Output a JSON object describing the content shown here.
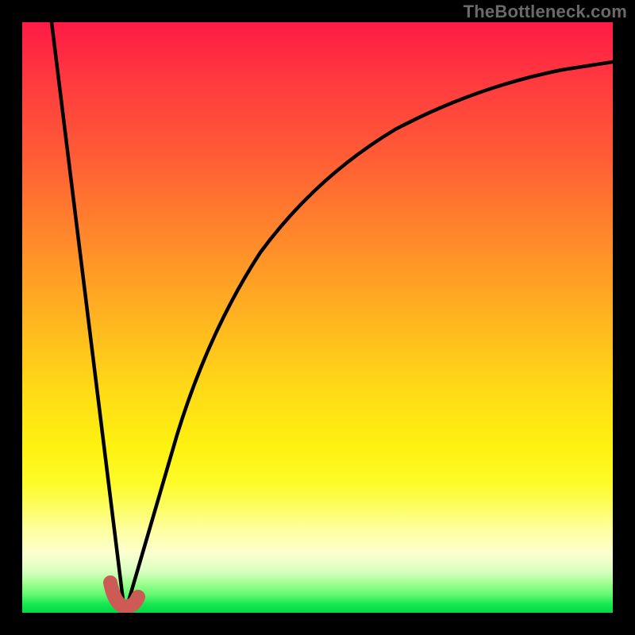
{
  "watermark": "TheBottleneck.com",
  "chart_data": {
    "type": "line",
    "title": "",
    "xlabel": "",
    "ylabel": "",
    "xlim": [
      0,
      100
    ],
    "ylim": [
      0,
      100
    ],
    "grid": false,
    "series": [
      {
        "name": "left-descent",
        "x": [
          5,
          10,
          14,
          16
        ],
        "values": [
          100,
          54,
          14,
          1
        ]
      },
      {
        "name": "right-curve",
        "x": [
          17,
          20,
          24,
          30,
          38,
          48,
          60,
          75,
          90,
          100
        ],
        "values": [
          1,
          12,
          30,
          48,
          62,
          72,
          80,
          86,
          90,
          92
        ]
      },
      {
        "name": "valley-marker",
        "x": [
          14.5,
          15,
          16,
          17.5,
          18.5
        ],
        "values": [
          5,
          2,
          1,
          1.5,
          3
        ]
      }
    ],
    "gradient_stops": [
      {
        "pos": 0,
        "color": "#ff1a46"
      },
      {
        "pos": 50,
        "color": "#ffc11c"
      },
      {
        "pos": 80,
        "color": "#fdfc40"
      },
      {
        "pos": 100,
        "color": "#00d848"
      }
    ]
  }
}
